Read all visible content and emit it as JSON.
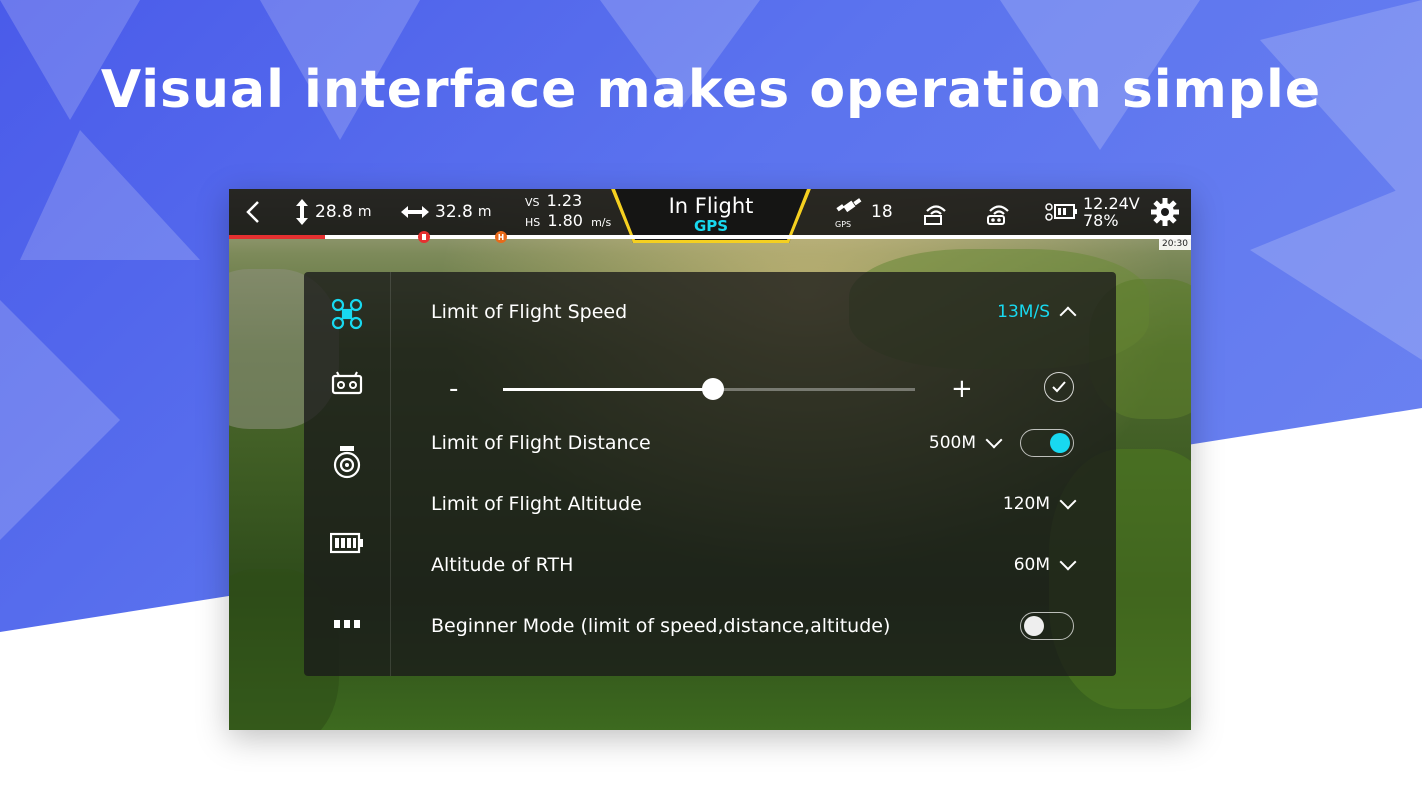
{
  "headline": "Visual interface makes operation simple",
  "colors": {
    "accent": "#18d9f0",
    "tab_underline": "#f5d020",
    "background_blue": "#5669ec"
  },
  "topbar": {
    "back_icon": "chevron-left-icon",
    "height": {
      "icon": "vertical-arrows-icon",
      "value": "28.8",
      "unit": "m"
    },
    "distance": {
      "icon": "horizontal-arrows-icon",
      "value": "32.8",
      "unit": "m"
    },
    "vs_label": "VS",
    "vs_value": "1.23",
    "hs_label": "HS",
    "hs_value": "1.80",
    "hs_unit": "m/s",
    "status_title": "In Flight",
    "status_mode": "GPS",
    "satellite_icon": "gps-satellite-icon",
    "satellite_badge": "GPS",
    "satellites": "18",
    "image_signal_icon": "image-transmission-icon",
    "remote_signal_icon": "remote-signal-icon",
    "battery_icon": "drone-battery-icon",
    "voltage": "12.24V",
    "battery_percent": "78%",
    "settings_icon": "gear-icon",
    "flight_time": "20:30"
  },
  "sidebar": {
    "items": [
      {
        "icon": "drone-icon",
        "active": true
      },
      {
        "icon": "remote-controller-icon",
        "active": false
      },
      {
        "icon": "camera-icon",
        "active": false
      },
      {
        "icon": "battery-icon",
        "active": false
      },
      {
        "icon": "more-icon",
        "active": false
      }
    ]
  },
  "settings": {
    "speed": {
      "label": "Limit of Flight Speed",
      "value": "13M/S",
      "slider_fraction": 0.51,
      "minus": "-",
      "plus": "+",
      "confirm_icon": "check-icon"
    },
    "distance": {
      "label": "Limit of Flight Distance",
      "value": "500M",
      "enabled": true
    },
    "altitude": {
      "label": "Limit of Flight Altitude",
      "value": "120M"
    },
    "rth": {
      "label": "Altitude of RTH",
      "value": "60M"
    },
    "beginner": {
      "label": "Beginner Mode (limit of speed,distance,altitude)",
      "enabled": false
    }
  }
}
